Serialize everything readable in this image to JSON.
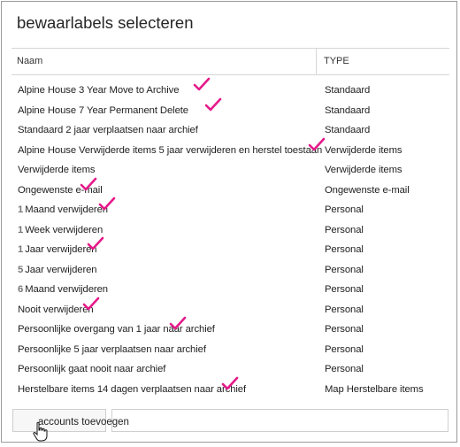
{
  "dialog": {
    "title": "bewaarlabels selecteren"
  },
  "table": {
    "columns": {
      "name": "Naam",
      "type": "TYPE"
    },
    "rows": [
      {
        "prefix": "",
        "name": "Alpine House 3 Year Move to Archive",
        "type": "Standaard",
        "checked": true
      },
      {
        "prefix": "",
        "name": "Alpine House 7 Year Permanent Delete",
        "type": "Standaard",
        "checked": true
      },
      {
        "prefix": "",
        "name": "Standaard 2 jaar verplaatsen naar archief",
        "type": "Standaard",
        "checked": false
      },
      {
        "prefix": "",
        "name": "Alpine House Verwijderde items 5 jaar verwijderen en herstel toestaan",
        "type": "Verwijderde items",
        "checked": true
      },
      {
        "prefix": "",
        "name": "Verwijderde items",
        "type": "Verwijderde items",
        "checked": false
      },
      {
        "prefix": "",
        "name": "Ongewenste e-mail",
        "type": "Ongewenste e-mail",
        "checked": true
      },
      {
        "prefix": "1",
        "name": "Maand verwijderen",
        "type": "Personal",
        "checked": true
      },
      {
        "prefix": "1",
        "name": "Week verwijderen",
        "type": "Personal",
        "checked": false
      },
      {
        "prefix": "1",
        "name": "Jaar verwijderen",
        "type": "Personal",
        "checked": true
      },
      {
        "prefix": "5",
        "name": "Jaar verwijderen",
        "type": "Personal",
        "checked": false
      },
      {
        "prefix": "6",
        "name": "Maand verwijderen",
        "type": "Personal",
        "checked": false
      },
      {
        "prefix": "",
        "name": "Nooit verwijderen",
        "type": "Personal",
        "checked": true
      },
      {
        "prefix": "",
        "name": "Persoonlijke overgang van 1 jaar naar archief",
        "type": "Personal",
        "checked": true
      },
      {
        "prefix": "",
        "name": "Persoonlijke 5 jaar verplaatsen naar archief",
        "type": "Personal",
        "checked": false
      },
      {
        "prefix": "",
        "name": "Persoonlijk gaat nooit naar archief",
        "type": "Personal",
        "checked": false
      },
      {
        "prefix": "",
        "name": "Herstelbare items 14 dagen verplaatsen naar archief",
        "type": "Map Herstelbare items",
        "checked": true
      }
    ]
  },
  "footer": {
    "add_label": "accounts toevoegen"
  },
  "colors": {
    "checkmark": "#e6198a"
  },
  "icons": {
    "checkmark": "checkmark-icon",
    "cursor": "hand-pointer-cursor"
  }
}
